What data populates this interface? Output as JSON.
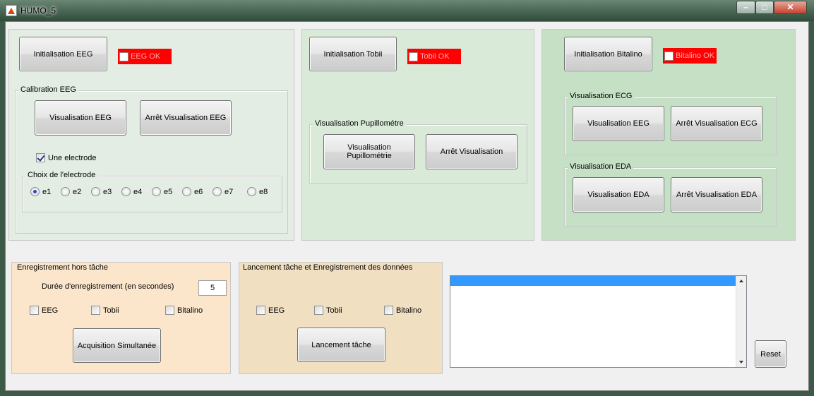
{
  "window": {
    "title": "HUMO_5",
    "controls": {
      "minimize": "–",
      "maximize": "□",
      "close": "✕"
    }
  },
  "eeg_panel": {
    "init_button": "Initialisation  EEG",
    "status_label": "EEG OK",
    "calibration": {
      "title": "Calibration EEG",
      "view_button": "Visualisation EEG",
      "stop_button": "Arrêt Visualisation EEG",
      "single_electrode": {
        "label": "Une electrode",
        "checked": true
      },
      "electrode_choice": {
        "title": "Choix de l'electrode",
        "options": [
          "e1",
          "e2",
          "e3",
          "e4",
          "e5",
          "e6",
          "e7",
          "e8"
        ],
        "selected": "e1"
      }
    }
  },
  "tobii_panel": {
    "init_button": "Initialisation  Tobii",
    "status_label": "Tobii OK",
    "pupillometer": {
      "title": "Visualisation Pupillométre",
      "view_button": "Visualisation Pupillométrie",
      "stop_button": "Arrêt Visualisation"
    }
  },
  "bitalino_panel": {
    "init_button": "Initialisation  Bitalino",
    "status_label": "Bitalino OK",
    "ecg": {
      "title": "Visualisation ECG",
      "view_button": "Visualisation EEG",
      "stop_button": "Arrêt Visualisation ECG"
    },
    "eda": {
      "title": "Visualisation EDA",
      "view_button": "Visualisation EDA",
      "stop_button": "Arrêt Visualisation EDA"
    }
  },
  "recording_panel": {
    "title": "Enregistrement hors tâche",
    "duration_label": "Durée d'enregistrement (en secondes)",
    "duration_value": "5",
    "checkboxes": [
      {
        "label": "EEG",
        "checked": false
      },
      {
        "label": "Tobii",
        "checked": false
      },
      {
        "label": "Bitalino",
        "checked": false
      }
    ],
    "acquire_button": "Acquisition Simultanée"
  },
  "launch_panel": {
    "title": "Lancement tâche et Enregistrement des données",
    "checkboxes": [
      {
        "label": "EEG",
        "checked": false
      },
      {
        "label": "Tobii",
        "checked": false
      },
      {
        "label": "Bitalino",
        "checked": false
      }
    ],
    "launch_button": "Lancement tâche"
  },
  "log": {
    "items": [
      ""
    ]
  },
  "reset_button": "Reset",
  "colors": {
    "status_red": "#ff0000",
    "eeg_panel_bg": "#e3ede4",
    "tobii_panel_bg": "#d9ead9",
    "bitalino_panel_bg": "#c6e0c6",
    "recording_bg": "#fbe6cb",
    "launch_bg": "#f1dfc2",
    "selection_blue": "#3399ff"
  }
}
